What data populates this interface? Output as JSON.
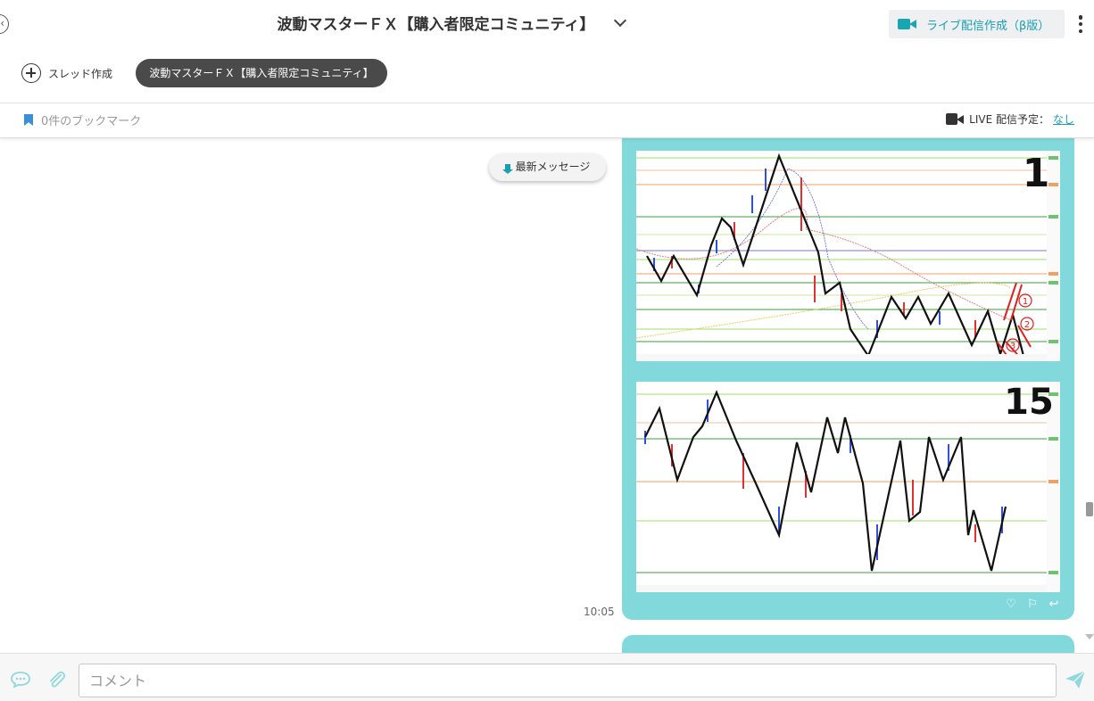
{
  "header": {
    "back_icon": "back-arrow-icon",
    "title": "波動マスターＦＸ【購入者限定コミュニティ】",
    "live_button_label": "ライブ配信作成（β版）",
    "live_button_icon_color": "#18a6b3"
  },
  "tabs": {
    "create_thread_label": "スレッド作成",
    "active_chip_label": "波動マスターＦＸ【購入者限定コミュニティ】"
  },
  "bookmark_bar": {
    "bookmark_label": "0件のブックマーク",
    "live_schedule_label": "LIVE 配信予定：",
    "live_schedule_value": "なし"
  },
  "chat": {
    "latest_messages_label": "最新メッセージ",
    "message": {
      "time": "10:05",
      "bubble_color": "#82d9dc",
      "images": [
        {
          "label": "1",
          "annotations": [
            "①",
            "②",
            "③"
          ]
        },
        {
          "label": "15"
        }
      ],
      "actions": [
        "heart-icon",
        "bookmark-icon",
        "reply-icon"
      ]
    }
  },
  "footer": {
    "comment_placeholder": "コメント",
    "accent_color": "#8fd8dd"
  }
}
